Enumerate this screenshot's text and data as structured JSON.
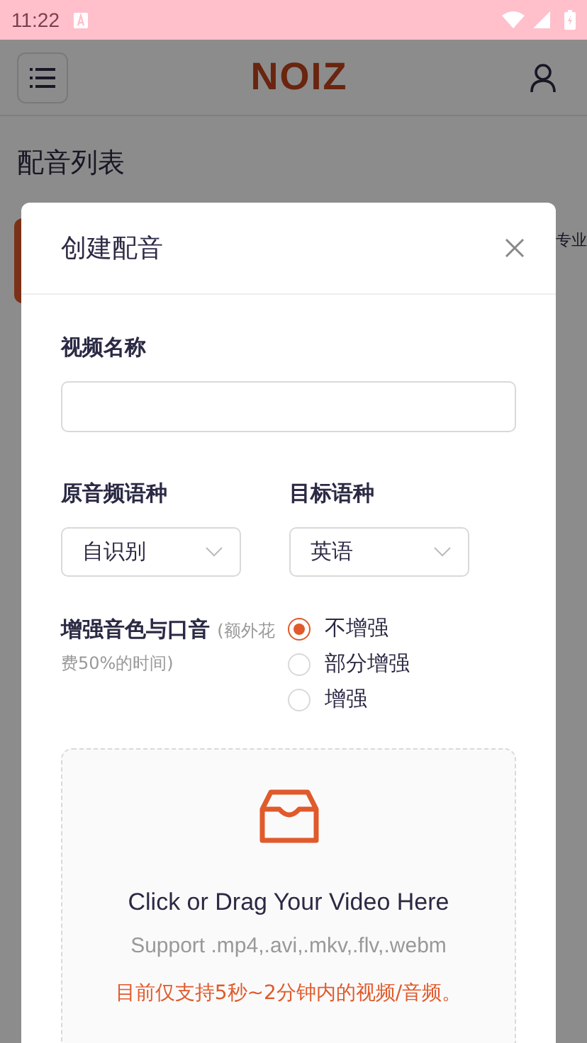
{
  "status_bar": {
    "time": "11:22"
  },
  "header": {
    "logo": "NOIZ"
  },
  "page": {
    "title": "配音列表",
    "side_text": "专业"
  },
  "dialog": {
    "title": "创建配音",
    "video_name": {
      "label": "视频名称"
    },
    "source_language": {
      "label": "原音频语种",
      "value": "自识别"
    },
    "target_language": {
      "label": "目标语种",
      "value": "英语"
    },
    "enhance": {
      "label": "增强音色与口音",
      "note": "(额外花费50%的时间)",
      "options": [
        {
          "label": "不增强",
          "selected": true
        },
        {
          "label": "部分增强",
          "selected": false
        },
        {
          "label": "增强",
          "selected": false
        }
      ]
    },
    "upload": {
      "title": "Click or Drag Your Video Here",
      "formats": "Support .mp4,.avi,.mkv,.flv,.webm",
      "notice": "目前仅支持5秒~2分钟内的视频/音频。"
    }
  }
}
